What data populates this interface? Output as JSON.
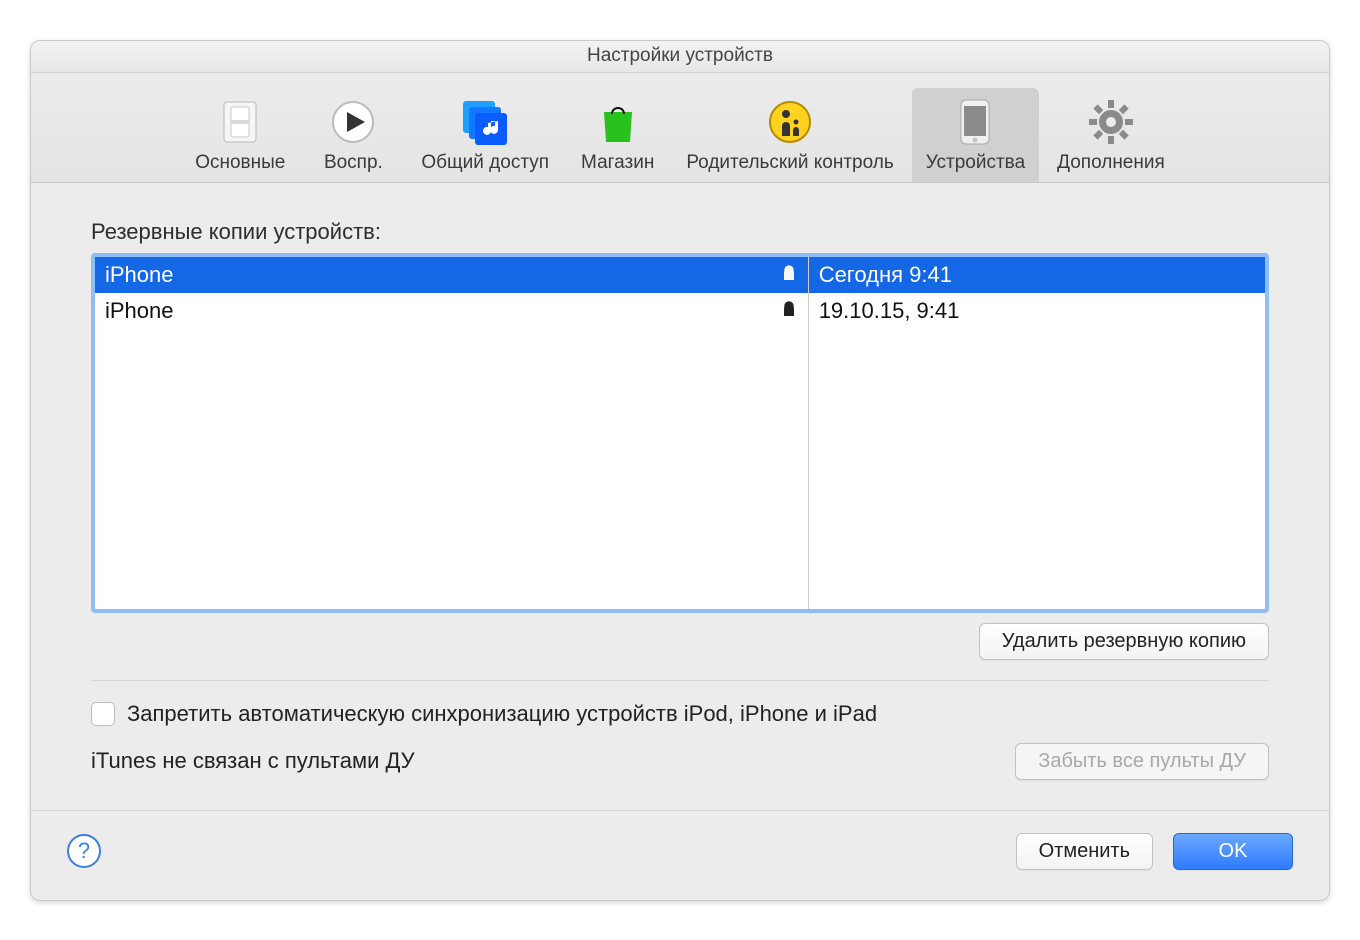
{
  "title": "Настройки устройств",
  "toolbar": [
    {
      "label": "Основные"
    },
    {
      "label": "Воспр."
    },
    {
      "label": "Общий доступ"
    },
    {
      "label": "Магазин"
    },
    {
      "label": "Родительский контроль"
    },
    {
      "label": "Устройства"
    },
    {
      "label": "Дополнения"
    }
  ],
  "section_label": "Резервные копии устройств:",
  "backups": [
    {
      "device": "iPhone",
      "date": "Сегодня 9:41",
      "encrypted": true,
      "selected": true
    },
    {
      "device": "iPhone",
      "date": "19.10.15, 9:41",
      "encrypted": true,
      "selected": false
    }
  ],
  "delete_button": "Удалить резервную копию",
  "checkbox_label": "Запретить автоматическую синхронизацию устройств iPod, iPhone и iPad",
  "remote_text": "iTunes не связан с пультами ДУ",
  "forget_remotes_button": "Забыть все пульты ДУ",
  "help": "?",
  "cancel_button": "Отменить",
  "ok_button": "OK"
}
